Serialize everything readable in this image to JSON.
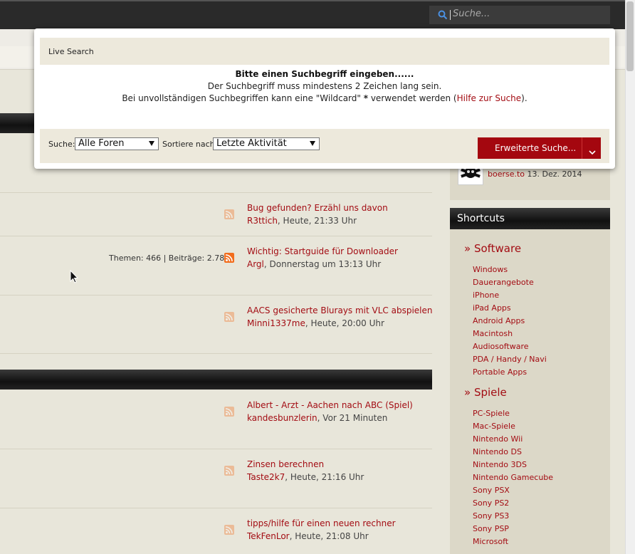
{
  "header": {
    "search_placeholder": "Suche..."
  },
  "live_search": {
    "title": "Live Search",
    "message_heading": "Bitte einen Suchbegriff eingeben......",
    "message_min_chars": "Der Suchbegriff muss mindestens 2 Zeichen lang sein.",
    "message_wildcard_prefix": "Bei unvollständigen Suchbegriffen kann eine \"Wildcard\" ",
    "message_wildcard_symbol": "*",
    "message_wildcard_mid": " verwendet werden (",
    "message_help_link": "Hilfe zur Suche",
    "message_wildcard_suffix": ").",
    "search_in_label": "Suche:",
    "search_in_value": "Alle Foren",
    "sort_label": "Sortiere nach:",
    "sort_value": "Letzte Aktivität",
    "advanced_button": "Erweiterte Suche..."
  },
  "forum_rows": [
    {
      "title": "Bug gefunden? Erzähl uns davon",
      "user": "R3ttich",
      "time": ", Heute, 21:33 Uhr",
      "stats": "",
      "rss_active": false
    },
    {
      "title": "Wichtig: Startguide für Downloader",
      "user": "Argl",
      "time": ", Donnerstag um 13:13 Uhr",
      "stats": "Themen: 466 | Beiträge: 2.786",
      "rss_active": true
    },
    {
      "title": "AACS gesicherte Blurays mit VLC abspielen",
      "user": "Minni1337me",
      "time": ", Heute, 20:00 Uhr",
      "stats": "",
      "rss_active": false
    },
    {
      "title": "Albert - Arzt - Aachen nach ABC (Spiel)",
      "user": "kandesbunzlerin",
      "time": ", Vor 21 Minuten",
      "stats": "",
      "rss_active": false
    },
    {
      "title": "Zinsen berechnen",
      "user": "Taste2k7",
      "time": ", Heute, 21:16 Uhr",
      "stats": "",
      "rss_active": false
    },
    {
      "title": "tipps/hilfe für einen neuen rechner",
      "user": "TekFenLor",
      "time": ", Heute, 21:08 Uhr",
      "stats": "",
      "rss_active": false
    }
  ],
  "sidebar_recent": {
    "user": "boerse.to",
    "date": " 13. Dez. 2014"
  },
  "shortcuts": {
    "title": "Shortcuts",
    "software_heading": "» Software",
    "software_links": [
      "Windows",
      "Dauerangebote",
      "iPhone",
      "iPad Apps",
      "Android Apps",
      "Macintosh",
      "Audiosoftware",
      "PDA / Handy / Navi",
      "Portable Apps"
    ],
    "games_heading": "» Spiele",
    "games_links": [
      "PC-Spiele",
      "Mac-Spiele",
      "Nintendo Wii",
      "Nintendo DS",
      "Nintendo 3DS",
      "Nintendo Gamecube",
      "Sony PSX",
      "Sony PS2",
      "Sony PS3",
      "Sony PSP",
      "Microsoft"
    ]
  },
  "colors": {
    "accent": "#a30c13",
    "button": "#a4070f",
    "rss": "#f26d1d",
    "background": "#e8e6da"
  }
}
